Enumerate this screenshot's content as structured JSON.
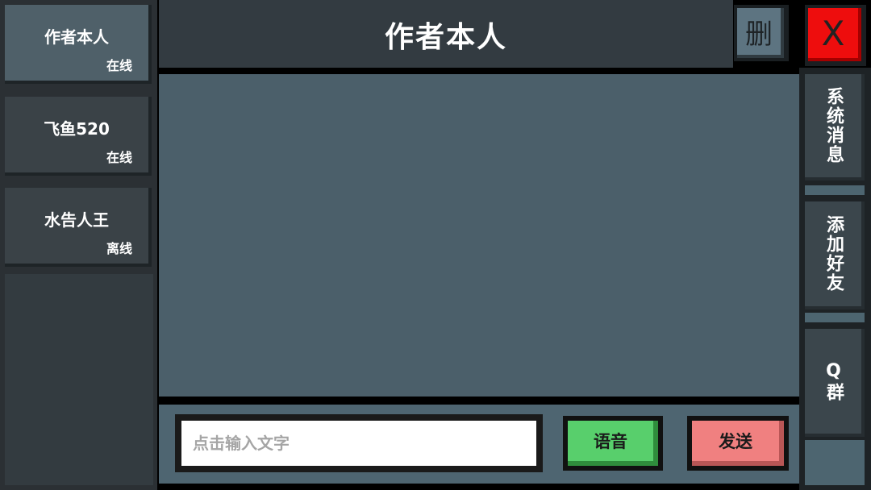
{
  "contacts": [
    {
      "name": "作者本人",
      "status": "在线",
      "active": true
    },
    {
      "name": "飞鱼520",
      "status": "在线",
      "active": false
    },
    {
      "name": "水告人王",
      "status": "离线",
      "active": false
    }
  ],
  "header": {
    "title": "作者本人"
  },
  "toolbar": {
    "delete_label": "删",
    "close_label": "X"
  },
  "sidebar": {
    "items": [
      {
        "label": "系统消息"
      },
      {
        "label": "添加好友"
      },
      {
        "label": "Q群"
      }
    ]
  },
  "input": {
    "placeholder": "点击输入文字",
    "value": ""
  },
  "buttons": {
    "voice_label": "语音",
    "send_label": "发送"
  },
  "colors": {
    "active_contact": "#4f6069",
    "chat_bg": "#4b5f6a",
    "voice_button": "#58cf6c",
    "send_button": "#f08080",
    "close_button": "#ee0d0d"
  }
}
